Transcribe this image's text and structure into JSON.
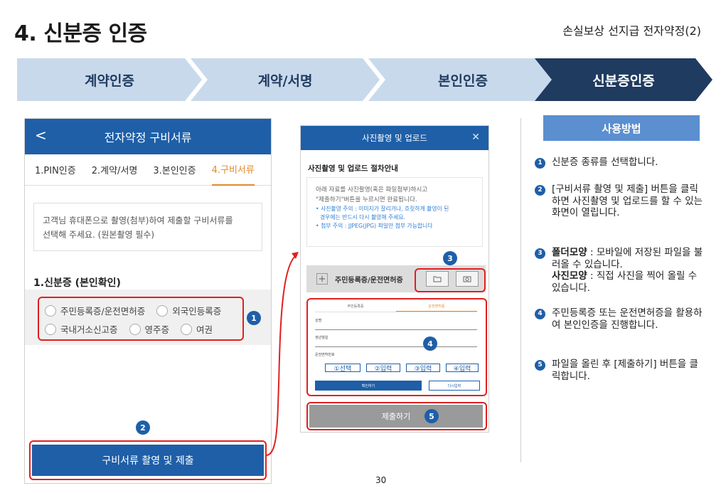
{
  "header": {
    "title": "4. 신분증 인증",
    "subtitle": "손실보상 선지급 전자약정(2)"
  },
  "steps": [
    "계약인증",
    "계약/서명",
    "본인인증",
    "신분증인증"
  ],
  "colors": {
    "primary": "#1e5fa8",
    "step_light": "#c9d9ec",
    "step_active": "#1f3b5f",
    "accent_orange": "#e28a2c",
    "highlight_red": "#e02020",
    "usage_header": "#5b8fd0"
  },
  "phone1": {
    "header_title": "전자약정 구비서류",
    "back_icon": "<",
    "tabs": [
      "1.PIN인증",
      "2.계약/서명",
      "3.본인인증",
      "4.구비서류"
    ],
    "active_tab": "4.구비서류",
    "notice_line1": "고객님 휴대폰으로 촬영(첨부)하여 제출할 구비서류를",
    "notice_line2": "선택해 주세요. (원본촬영 필수)",
    "section_title": "1.신분증 (본인확인)",
    "radio_row1": [
      "주민등록증/운전면허증",
      "외국인등록증"
    ],
    "radio_row2": [
      "국내거소신고증",
      "영주증",
      "여권"
    ],
    "submit_button": "구비서류 촬영 및 제출",
    "badge_1": "1",
    "badge_2": "2"
  },
  "phone2": {
    "header_title": "사진촬영 및 업로드",
    "close_icon": "✕",
    "guide_heading": "사진촬영 및 업로드 절차안내",
    "guide_line1": "아래 자료를 사진촬영(혹은 파일첨부)하시고",
    "guide_line2": "\"제출하기\"버튼을 누르시면 완료됩니다.",
    "guide_note1": "• 사진촬영 주의 : 이미지가 잘리거나, 흐릿하게 촬영이 된",
    "guide_note2": "경우에는 반드시 다시 촬영해 주세요.",
    "guide_note3": "• 첨부 주의 : JJPEG(JPG) 파일만 첨부 가능합니다",
    "id_row_label": "주민등록증/운전면허증",
    "plus_icon": "+",
    "form_tabs": [
      "주민등록증",
      "운전면허증"
    ],
    "form_labels": [
      "성명",
      "생년월일",
      "운전면허번호"
    ],
    "license_fields": [
      "①선택",
      "②입력",
      "③입력",
      "④입력"
    ],
    "confirm_button": "확인하기",
    "retake_button": "다시입력",
    "submit_button": "제출하기",
    "badge_3": "3",
    "badge_4": "4",
    "badge_5": "5"
  },
  "instructions": {
    "title": "사용방법",
    "items": [
      {
        "num": "1",
        "text": "신분증 종류를 선택합니다."
      },
      {
        "num": "2",
        "text": "[구비서류 촬영 및 제출] 버튼을 클릭하면 사진촬영 및 업로드를 할 수 있는 화면이 열립니다."
      },
      {
        "num": "3",
        "bold1": "폴더모양",
        "text1": " : 모바일에 저장된 파일을 불러올 수 있습니다.",
        "bold2": "사진모양",
        "text2": " : 직접 사진을 찍어 올릴 수 있습니다."
      },
      {
        "num": "4",
        "text": "주민등록증 또는 운전면허증을 활용하여 본인인증을 진행합니다."
      },
      {
        "num": "5",
        "text": "파일을 올린 후 [제출하기] 버튼을 클릭합니다."
      }
    ]
  },
  "page_number": "30"
}
